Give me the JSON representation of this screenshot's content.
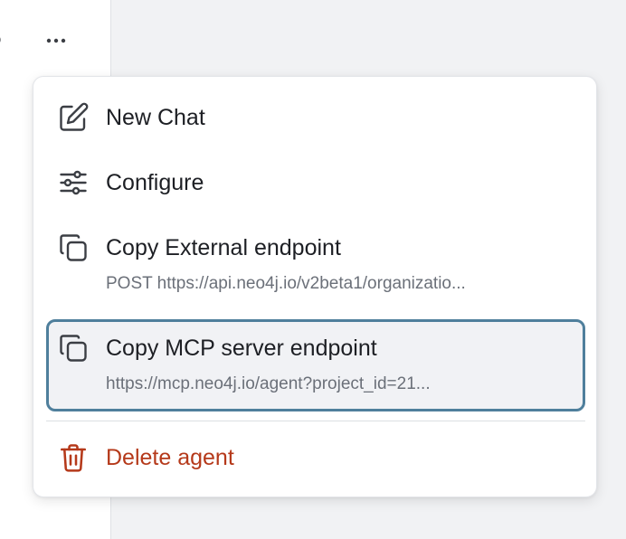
{
  "toolbar": {
    "more_icon": "more-horizontal-icon"
  },
  "menu": {
    "items": [
      {
        "icon": "edit-icon",
        "label": "New Chat"
      },
      {
        "icon": "sliders-icon",
        "label": "Configure"
      },
      {
        "icon": "copy-icon",
        "label": "Copy External endpoint",
        "sublabel": "POST https://api.neo4j.io/v2beta1/organizatio..."
      },
      {
        "icon": "copy-icon",
        "label": "Copy MCP server endpoint",
        "sublabel": "https://mcp.neo4j.io/agent?project_id=21..."
      },
      {
        "icon": "trash-icon",
        "label": "Delete agent"
      }
    ]
  },
  "colors": {
    "danger": "#b5391a",
    "focus_ring": "#4f7f9c",
    "text": "#1d1f24",
    "muted_text": "#6b7079"
  }
}
